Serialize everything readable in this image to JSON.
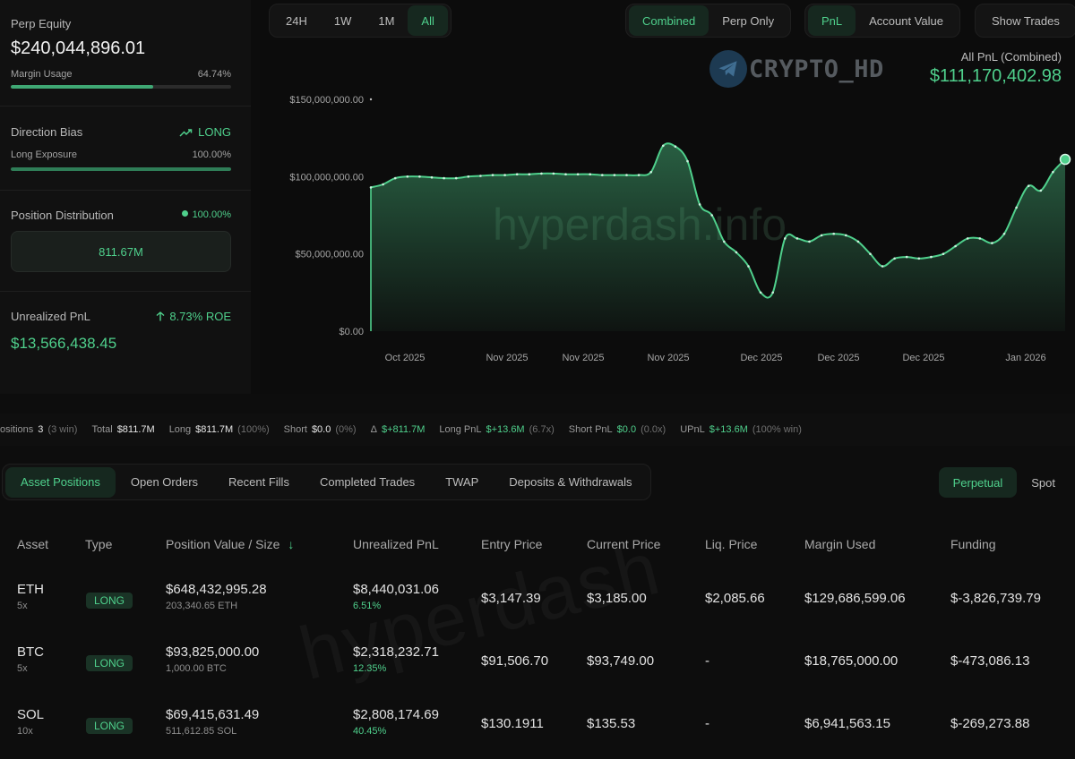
{
  "perp_equity": {
    "label": "Perp Equity",
    "value": "$240,044,896.01",
    "margin_label": "Margin Usage",
    "margin_value": "64.74%",
    "margin_fraction": 0.6474
  },
  "direction_bias": {
    "label": "Direction Bias",
    "value": "LONG",
    "exposure_label": "Long Exposure",
    "exposure_value": "100.00%",
    "exposure_fraction": 1.0
  },
  "position_distribution": {
    "label": "Position Distribution",
    "value": "100.00%",
    "box_value": "811.67M"
  },
  "unrealized": {
    "label": "Unrealized PnL",
    "roe": "8.73% ROE",
    "value": "$13,566,438.45"
  },
  "time_range": {
    "items": [
      "24H",
      "1W",
      "1M",
      "All"
    ],
    "active": "All"
  },
  "scope_toggle": {
    "items": [
      "Combined",
      "Perp Only"
    ],
    "active": "Combined"
  },
  "metric_toggle": {
    "items": [
      "PnL",
      "Account Value"
    ],
    "active": "PnL"
  },
  "show_trades_label": "Show Trades",
  "watermark": {
    "brand": "CRYPTO_HD",
    "site": "hyperdash.info",
    "site2": "hyperdash"
  },
  "pnl_summary": {
    "title": "All PnL (Combined)",
    "value": "$111,170,402.98"
  },
  "chart_data": {
    "type": "area",
    "title": "",
    "xlabel": "",
    "ylabel": "",
    "ylim": [
      0,
      150000000
    ],
    "y_ticks": [
      0,
      50000000,
      100000000,
      150000000
    ],
    "y_tick_labels": [
      "$0.00",
      "$50,000,000.00",
      "$100,000,000.00",
      "$150,000,000.00"
    ],
    "x_tick_labels": [
      "Oct 2025",
      "Nov 2025",
      "Nov 2025",
      "Nov 2025",
      "Dec 2025",
      "Dec 2025",
      "Dec 2025",
      "Jan 2026"
    ],
    "grid": false,
    "color": "#4fd08c",
    "series": [
      {
        "values": [
          93000000,
          95000000,
          99000000,
          100000000,
          100000000,
          99500000,
          99000000,
          99000000,
          100000000,
          100500000,
          101000000,
          101000000,
          101500000,
          101500000,
          102000000,
          102000000,
          101500000,
          101500000,
          101500000,
          101000000,
          101000000,
          101000000,
          101000000,
          103000000,
          120000000,
          119500000,
          110000000,
          82000000,
          75000000,
          58000000,
          51000000,
          42000000,
          25000000,
          25000000,
          60000000,
          60000000,
          58000000,
          62000000,
          63000000,
          62000000,
          58000000,
          50000000,
          42000000,
          47000000,
          48000000,
          47000000,
          48000000,
          50000000,
          55000000,
          60000000,
          60000000,
          57000000,
          63000000,
          80000000,
          94000000,
          91000000,
          103000000,
          111170402.98
        ]
      }
    ]
  },
  "summary_strip": [
    {
      "key": "ositions",
      "value": "3",
      "paren": "(3 win)",
      "green": false
    },
    {
      "key": "Total",
      "value": "$811.7M",
      "paren": "",
      "green": false
    },
    {
      "key": "Long",
      "value": "$811.7M",
      "paren": "(100%)",
      "green": false
    },
    {
      "key": "Short",
      "value": "$0.0",
      "paren": "(0%)",
      "green": false
    },
    {
      "key": "Δ",
      "value": "$+811.7M",
      "paren": "",
      "green": true
    },
    {
      "key": "Long PnL",
      "value": "$+13.6M",
      "paren": "(6.7x)",
      "green": true
    },
    {
      "key": "Short PnL",
      "value": "$0.0",
      "paren": "(0.0x)",
      "green": true
    },
    {
      "key": "UPnL",
      "value": "$+13.6M",
      "paren": "(100% win)",
      "green": true
    }
  ],
  "tabs": {
    "items": [
      "Asset Positions",
      "Open Orders",
      "Recent Fills",
      "Completed Trades",
      "TWAP",
      "Deposits & Withdrawals"
    ],
    "active": "Asset Positions"
  },
  "market_toggle": {
    "items": [
      "Perpetual",
      "Spot"
    ],
    "active": "Perpetual"
  },
  "table": {
    "headers": [
      "Asset",
      "Type",
      "Position Value / Size",
      "Unrealized PnL",
      "Entry Price",
      "Current Price",
      "Liq. Price",
      "Margin Used",
      "Funding"
    ],
    "sort_indicator": "↓",
    "rows": [
      {
        "asset": "ETH",
        "leverage": "5x",
        "type": "LONG",
        "value": "$648,432,995.28",
        "size": "203,340.65 ETH",
        "upnl": "$8,440,031.06",
        "upnl_pct": "6.51%",
        "entry": "$3,147.39",
        "current": "$3,185.00",
        "liq": "$2,085.66",
        "margin": "$129,686,599.06",
        "funding": "$-3,826,739.79"
      },
      {
        "asset": "BTC",
        "leverage": "5x",
        "type": "LONG",
        "value": "$93,825,000.00",
        "size": "1,000.00 BTC",
        "upnl": "$2,318,232.71",
        "upnl_pct": "12.35%",
        "entry": "$91,506.70",
        "current": "$93,749.00",
        "liq": "-",
        "margin": "$18,765,000.00",
        "funding": "$-473,086.13"
      },
      {
        "asset": "SOL",
        "leverage": "10x",
        "type": "LONG",
        "value": "$69,415,631.49",
        "size": "511,612.85 SOL",
        "upnl": "$2,808,174.69",
        "upnl_pct": "40.45%",
        "entry": "$130.1911",
        "current": "$135.53",
        "liq": "-",
        "margin": "$6,941,563.15",
        "funding": "$-269,273.88"
      }
    ]
  }
}
